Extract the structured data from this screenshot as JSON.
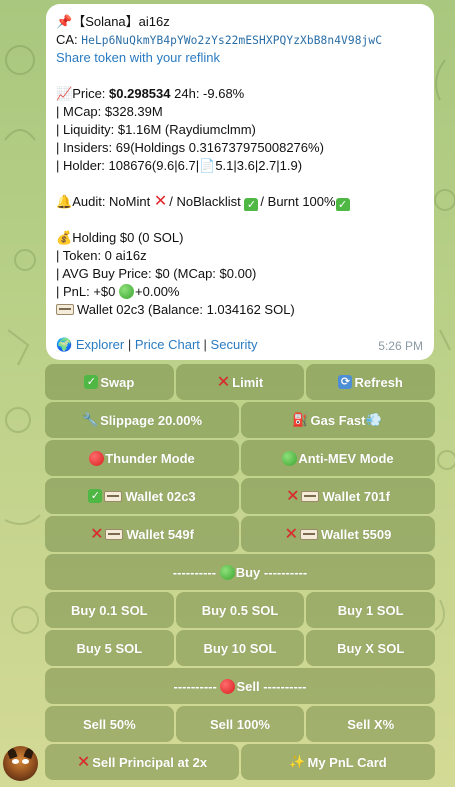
{
  "message": {
    "title_icon": "pushpin-icon",
    "title": "【Solana】ai16z",
    "ca_label": "CA:",
    "ca_value": "HeLp6NuQkmYB4pYWo2zYs22mESHXPQYzXbB8n4V98jwC",
    "share_link": "Share token with your reflink",
    "price_label": "Price:",
    "price_value": "$0.298534",
    "change_24h": "24h: -9.68%",
    "mcap": "| MCap: $328.39M",
    "liquidity": "| Liquidity: $1.16M (Raydiumclmm)",
    "insiders": "| Insiders: 69(Holdings 0.316737975008276%)",
    "holder_prefix": "| Holder: 108676(9.6|6.7|",
    "holder_suffix": "5.1|3.6|2.7|1.9)",
    "audit_prefix": "Audit: NoMint",
    "audit_mid": "/ NoBlacklist",
    "audit_suffix": "/ Burnt 100%",
    "holding": "Holding $0 (0 SOL)",
    "token": "| Token: 0 ai16z",
    "avg_buy": "| AVG Buy Price: $0 (MCap: $0.00)",
    "pnl_prefix": "| PnL: +$0",
    "pnl_suffix": "+0.00%",
    "wallet_line": "Wallet 02c3 (Balance: 1.034162 SOL)",
    "link_explorer": "Explorer",
    "link_price_chart": "Price Chart",
    "link_security": "Security",
    "separator": "|",
    "time": "5:26 PM"
  },
  "keyboard": {
    "swap": "Swap",
    "limit": "Limit",
    "refresh": "Refresh",
    "slippage": "Slippage 20.00%",
    "gas": "Gas Fast",
    "thunder": "Thunder Mode",
    "anti_mev": "Anti-MEV Mode",
    "wallet_02c3": "Wallet 02c3",
    "wallet_701f": "Wallet 701f",
    "wallet_549f": "Wallet 549f",
    "wallet_5509": "Wallet 5509",
    "buy_header_left": "----------",
    "buy_header": "Buy",
    "buy_header_right": "----------",
    "buy_01": "Buy 0.1 SOL",
    "buy_05": "Buy 0.5 SOL",
    "buy_1": "Buy 1 SOL",
    "buy_5": "Buy 5 SOL",
    "buy_10": "Buy 10 SOL",
    "buy_x": "Buy X SOL",
    "sell_header_left": "----------",
    "sell_header": "Sell",
    "sell_header_right": "----------",
    "sell_50": "Sell 50%",
    "sell_100": "Sell 100%",
    "sell_x": "Sell X%",
    "sell_principal": "Sell Principal at 2x",
    "pnl_card": "My PnL Card"
  },
  "colors": {
    "accent_link": "#2a7bc1",
    "button_bg": "#7c9550",
    "check_green": "#4fb845",
    "cross_red": "#e0262c"
  }
}
